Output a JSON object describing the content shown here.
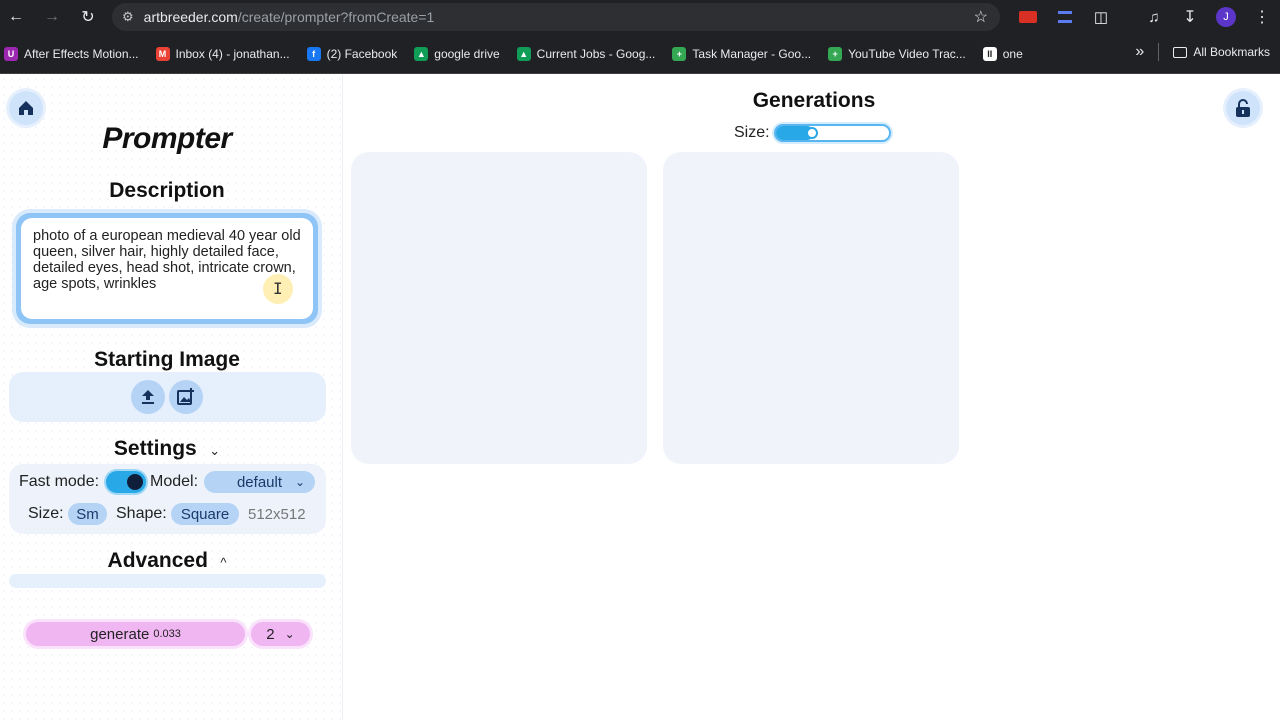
{
  "browser": {
    "url_host": "artbreeder.com",
    "url_path": "/create/prompter?fromCreate=1",
    "profile_initial": "J",
    "bookmarks": [
      {
        "label": "After Effects Motion...",
        "color": "#9c27b0",
        "glyph": "U"
      },
      {
        "label": "Inbox (4) - jonathan...",
        "color": "#ea4335",
        "glyph": "M"
      },
      {
        "label": "(2) Facebook",
        "color": "#1877f2",
        "glyph": "f"
      },
      {
        "label": "google drive",
        "color": "#0f9d58",
        "glyph": "▲"
      },
      {
        "label": "Current Jobs - Goog...",
        "color": "#0f9d58",
        "glyph": "▲"
      },
      {
        "label": "Task Manager - Goo...",
        "color": "#34a853",
        "glyph": "+"
      },
      {
        "label": "YouTube Video Trac...",
        "color": "#34a853",
        "glyph": "+"
      },
      {
        "label": "one",
        "color": "#ffffff",
        "glyph": "II"
      }
    ],
    "more_label": "»",
    "all_bookmarks_label": "All Bookmarks"
  },
  "sidebar": {
    "title": "Prompter",
    "description_heading": "Description",
    "description_text": "photo of a european medieval 40 year old queen, silver hair, highly detailed face, detailed eyes, head shot, intricate crown, age spots, wrinkles",
    "starting_image_heading": "Starting Image",
    "settings_heading": "Settings",
    "settings_chevron": "⌄",
    "fast_mode_label": "Fast mode:",
    "fast_mode_on": true,
    "model_label": "Model:",
    "model_value": "default",
    "size_label": "Size:",
    "size_value": "Sm",
    "shape_label": "Shape:",
    "shape_value": "Square",
    "dimensions": "512x512",
    "advanced_heading": "Advanced",
    "advanced_chevron": "^",
    "generate_label": "generate",
    "generate_cost": "0.033",
    "count_value": "2"
  },
  "main": {
    "title": "Generations",
    "size_label": "Size:",
    "size_slider_value": 0.25
  }
}
